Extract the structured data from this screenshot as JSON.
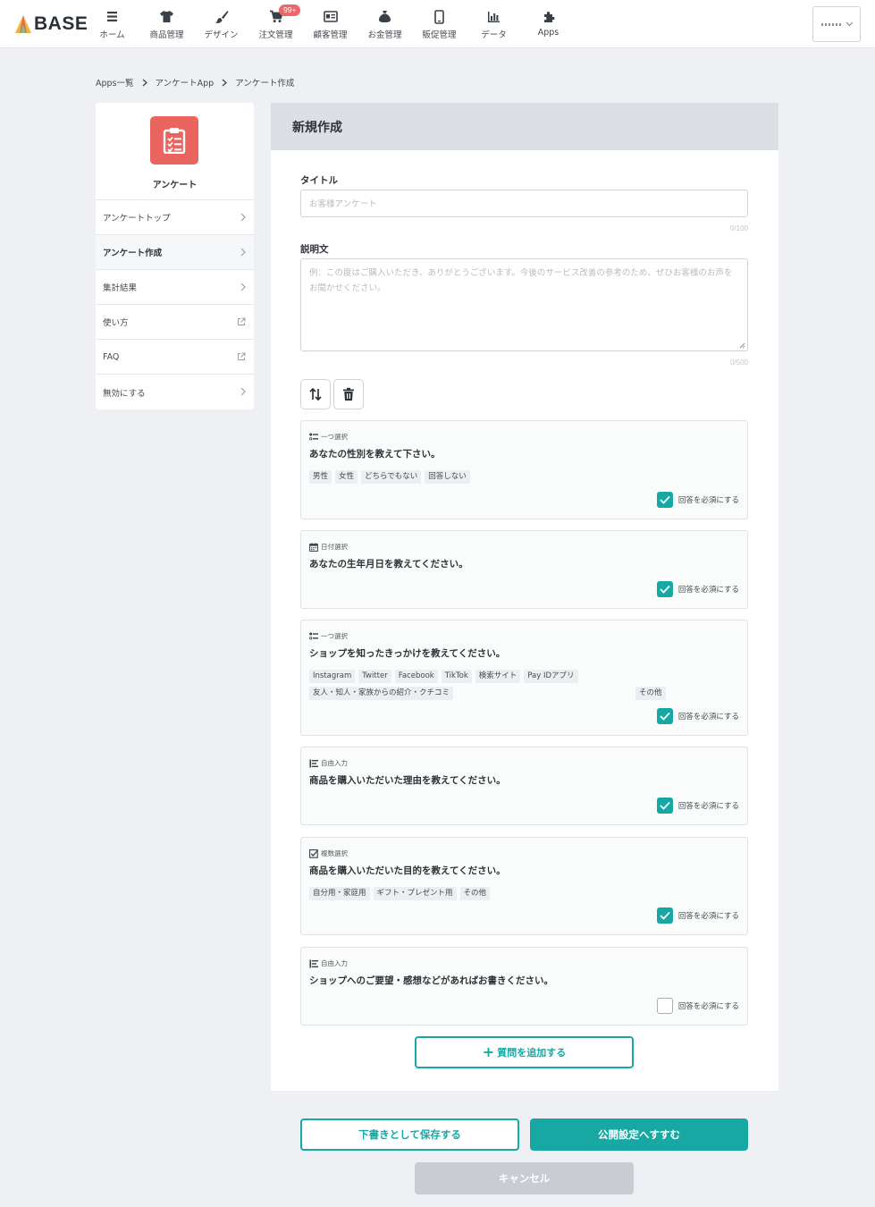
{
  "header": {
    "logo_text": "BASE",
    "nav": [
      {
        "label": "ホーム",
        "icon": "home-list-icon"
      },
      {
        "label": "商品管理",
        "icon": "tshirt-icon"
      },
      {
        "label": "デザイン",
        "icon": "brush-icon"
      },
      {
        "label": "注文管理",
        "icon": "cart-icon",
        "badge": "99+"
      },
      {
        "label": "顧客管理",
        "icon": "id-card-icon"
      },
      {
        "label": "お金管理",
        "icon": "money-bag-icon"
      },
      {
        "label": "販促管理",
        "icon": "smartphone-icon"
      },
      {
        "label": "データ",
        "icon": "bar-chart-icon"
      },
      {
        "label": "Apps",
        "icon": "puzzle-icon"
      }
    ]
  },
  "breadcrumb": [
    "Apps一覧",
    "アンケートApp",
    "アンケート作成"
  ],
  "sidebar": {
    "app_name": "アンケート",
    "items": [
      {
        "label": "アンケートトップ",
        "trail": "chevron"
      },
      {
        "label": "アンケート作成",
        "trail": "chevron",
        "active": true
      },
      {
        "label": "集計結果",
        "trail": "chevron"
      },
      {
        "label": "使い方",
        "trail": "external"
      },
      {
        "label": "FAQ",
        "trail": "external"
      },
      {
        "label": "無効にする",
        "trail": "chevron"
      }
    ]
  },
  "form": {
    "heading": "新規作成",
    "title_label": "タイトル",
    "title_placeholder": "お客様アンケート",
    "title_count": "0/100",
    "desc_label": "説明文",
    "desc_placeholder": "例：この度はご購入いただき、ありがとうございます。今後のサービス改善の参考のため、ぜひお客様のお声をお聞かせください。",
    "desc_count": "0/500",
    "required_label": "回答を必須にする",
    "add_question": "質問を追加する"
  },
  "questions": [
    {
      "type": "一つ選択",
      "icon": "single-choice-icon",
      "text": "あなたの性別を教えて下さい。",
      "options": [
        "男性",
        "女性",
        "どちらでもない",
        "回答しない"
      ],
      "required": true
    },
    {
      "type": "日付選択",
      "icon": "calendar-icon",
      "text": "あなたの生年月日を教えてください。",
      "options": [],
      "required": true
    },
    {
      "type": "一つ選択",
      "icon": "single-choice-icon",
      "text": "ショップを知ったきっかけを教えてください。",
      "options": [
        "Instagram",
        "Twitter",
        "Facebook",
        "TikTok",
        "検索サイト",
        "Pay IDアプリ",
        "友人・知人・家族からの紹介・クチコミ",
        "その他"
      ],
      "required": true
    },
    {
      "type": "自由入力",
      "icon": "free-text-icon",
      "text": "商品を購入いただいた理由を教えてください。",
      "options": [],
      "required": true
    },
    {
      "type": "複数選択",
      "icon": "multi-choice-icon",
      "text": "商品を購入いただいた目的を教えてください。",
      "options": [
        "自分用・家庭用",
        "ギフト・プレゼント用",
        "その他"
      ],
      "required": true
    },
    {
      "type": "自由入力",
      "icon": "free-text-icon",
      "text": "ショップへのご要望・感想などがあればお書きください。",
      "options": [],
      "required": false
    }
  ],
  "actions": {
    "draft": "下書きとして保存する",
    "publish": "公開設定へすすむ",
    "cancel": "キャンセル"
  },
  "colors": {
    "accent": "#17a8a4",
    "app_icon": "#ea6560",
    "badge": "#e8686b"
  }
}
